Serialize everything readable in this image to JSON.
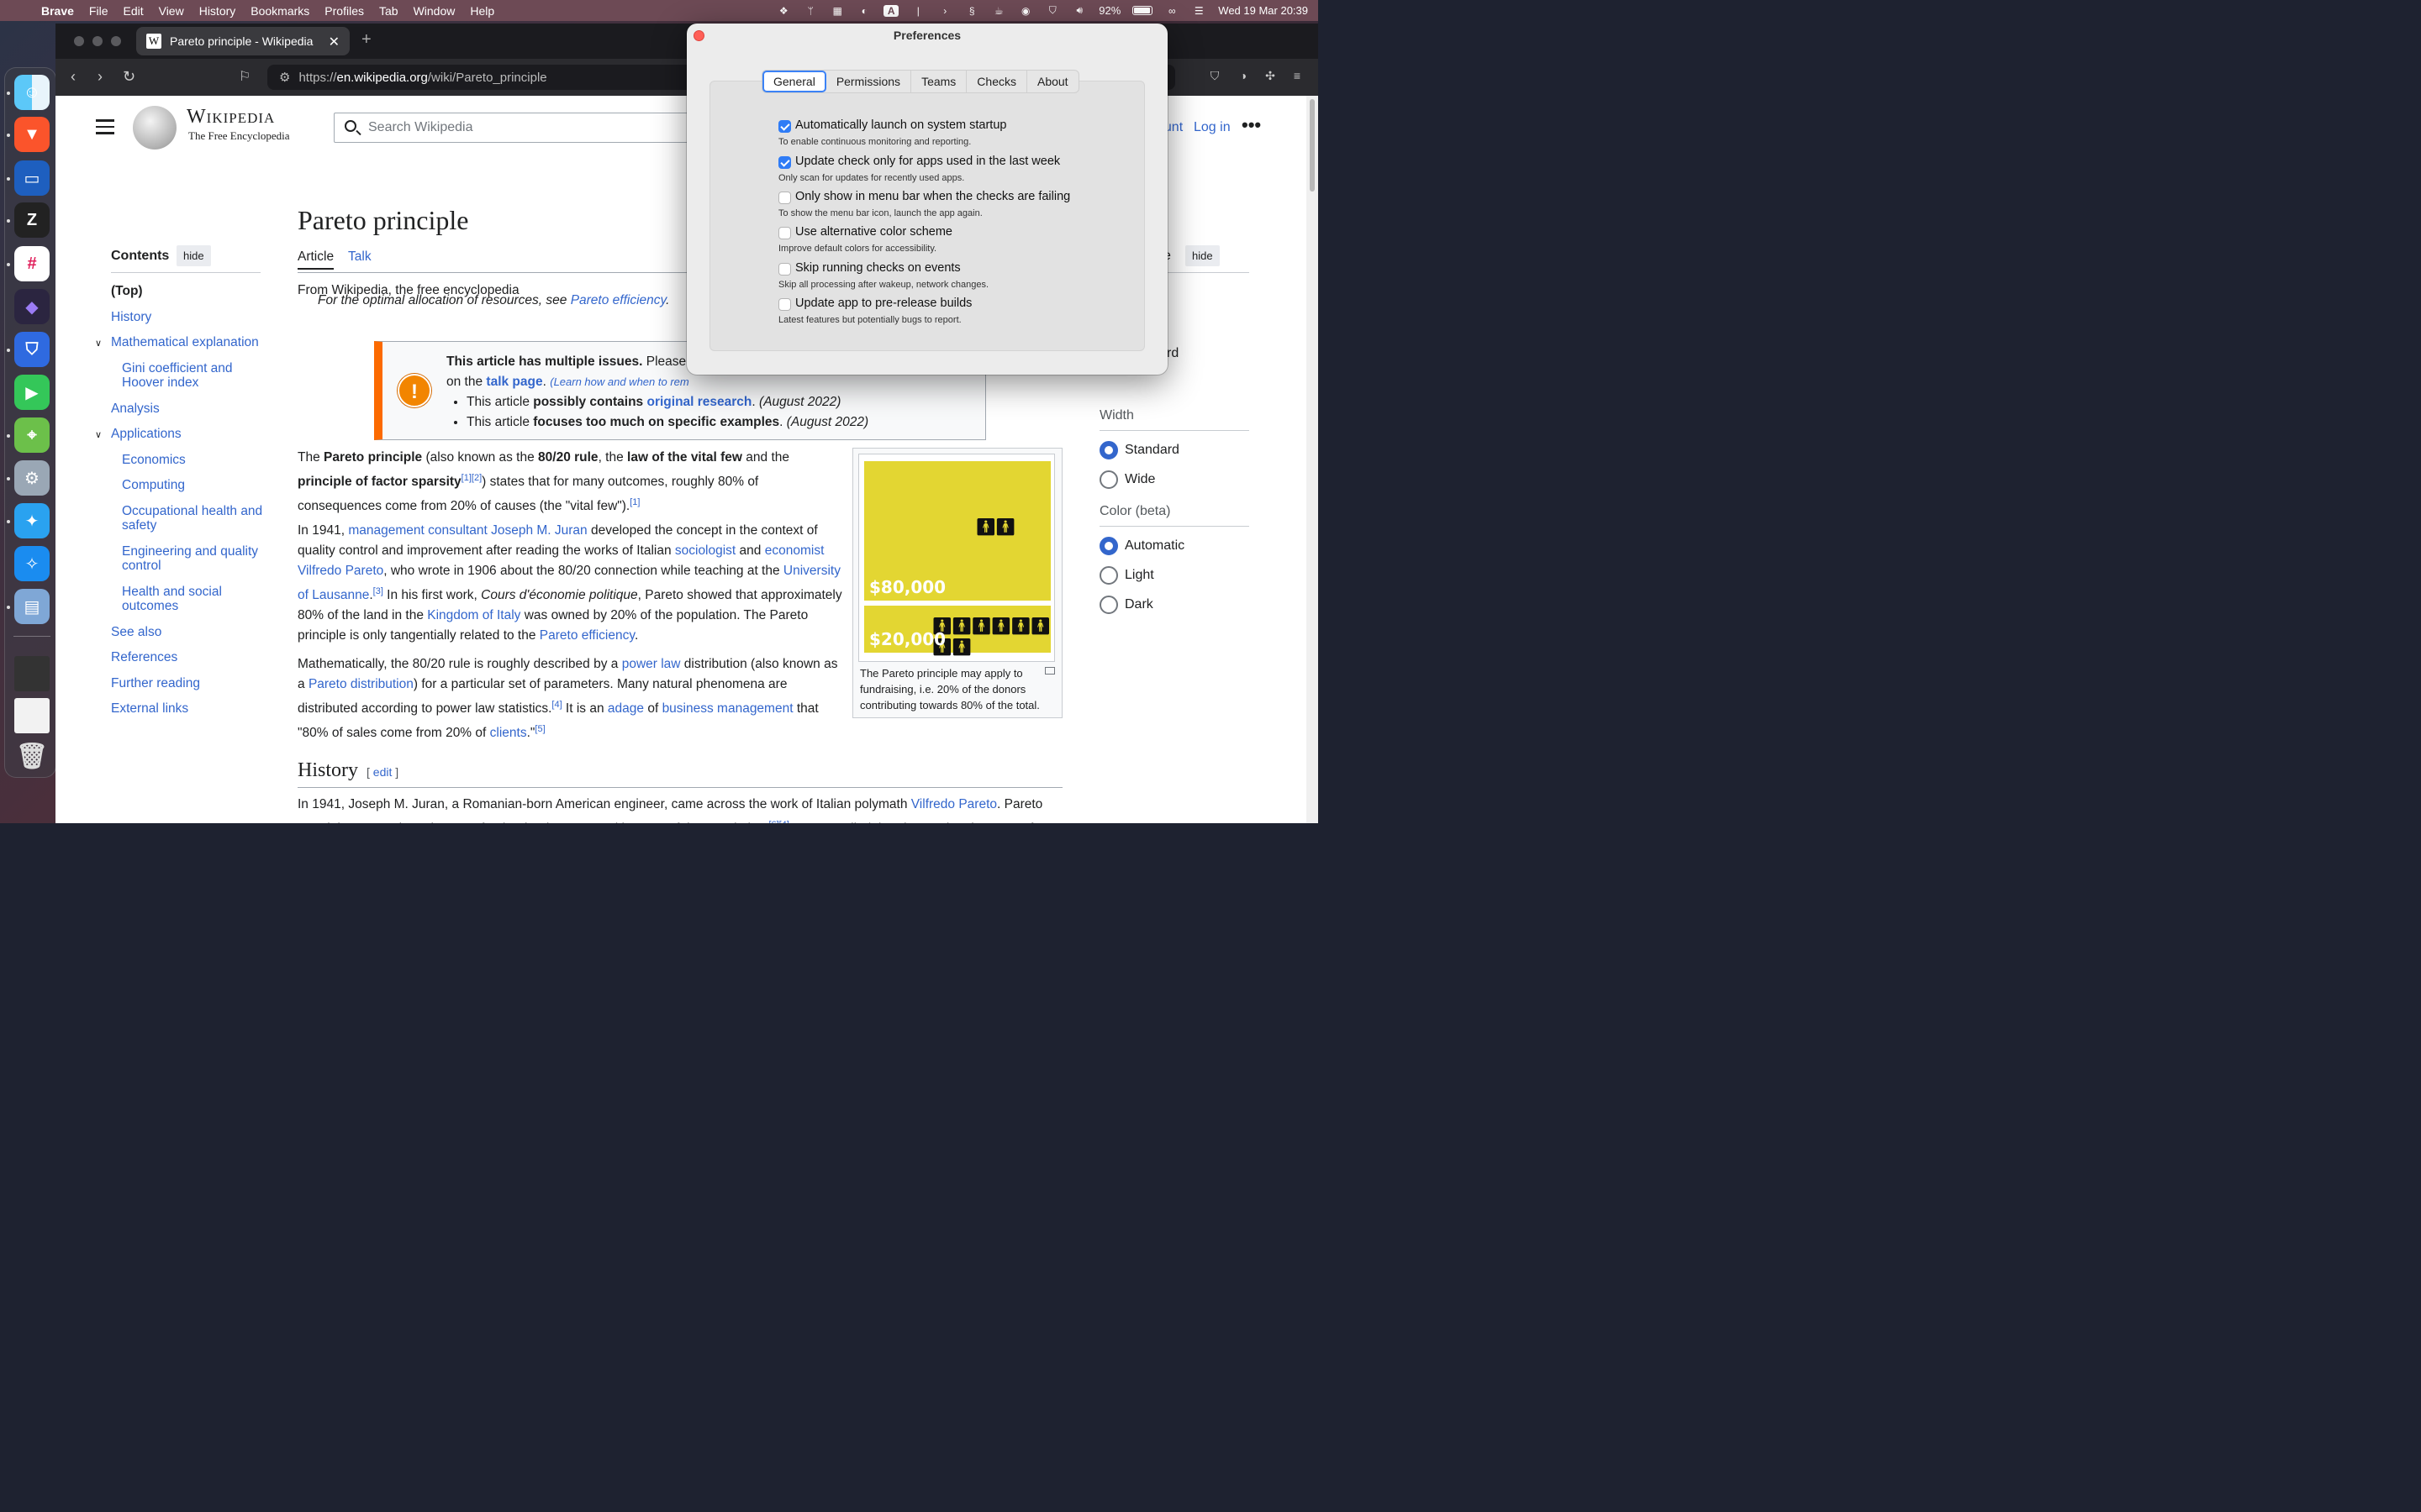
{
  "menubar": {
    "app": "Brave",
    "items": [
      "File",
      "Edit",
      "View",
      "History",
      "Bookmarks",
      "Profiles",
      "Tab",
      "Window",
      "Help"
    ],
    "battery": "92%",
    "datetime": "Wed 19 Mar  20:39"
  },
  "browser": {
    "tab_title": "Pareto principle - Wikipedia",
    "url_scheme": "https://",
    "url_host": "en.wikipedia.org",
    "url_path": "/wiki/Pareto_principle"
  },
  "wiki": {
    "wordmark": "Wikipedia",
    "tagline": "The Free Encyclopedia",
    "search_placeholder": "Search Wikipedia",
    "account_fragment": "ount",
    "login": "Log in",
    "toc": {
      "title": "Contents",
      "hide": "hide",
      "items": [
        "(Top)",
        "History",
        "Mathematical explanation",
        "Gini coefficient and",
        "Hoover index",
        "Analysis",
        "Applications",
        "Economics",
        "Computing",
        "Occupational health and",
        "safety",
        "Engineering and quality",
        "control",
        "Health and social",
        "outcomes",
        "See also",
        "References",
        "Further reading",
        "External links"
      ]
    },
    "article": {
      "title": "Pareto principle",
      "tab_article": "Article",
      "tab_talk": "Talk",
      "from": "From Wikipedia, the free encyclopedia",
      "hatnote_pre": "For the optimal allocation of resources, see ",
      "hatnote_link": "Pareto efficiency",
      "hatnote_post": ".",
      "ambox_bold": "This article has multiple issues.",
      "ambox_rest": " Please",
      "ambox_line2_pre": "on the ",
      "ambox_talk": "talk page",
      "ambox_line2_small": "(Learn how and when to rem",
      "ambox_b1_pre": "This article ",
      "ambox_b1_bold": "possibly contains",
      "ambox_b1_link": "original research",
      "ambox_b1_date": "(August 2022)",
      "ambox_b2_pre": "This article ",
      "ambox_b2_bold": "focuses too much on specific examples",
      "ambox_b2_date": "(August 2022)",
      "h2_history": "History",
      "h2_edit": "edit"
    },
    "infobox": {
      "big_amount": "$80,000",
      "small_amount": "$20,000",
      "caption": "The Pareto principle may apply to fundraising, i.e. 20% of the donors contributing towards 80% of the total."
    },
    "appearance": {
      "hide": "hide",
      "fragment_e": "e",
      "fragment_rd": "rd",
      "width_label": "Width",
      "width_options": [
        "Standard",
        "Wide"
      ],
      "color_label": "Color (beta)",
      "color_options": [
        "Automatic",
        "Light",
        "Dark"
      ]
    }
  },
  "prefs": {
    "title": "Preferences",
    "tabs": [
      "General",
      "Permissions",
      "Teams",
      "Checks",
      "About"
    ],
    "options": [
      {
        "label": "Automatically launch on system startup",
        "sub": "To enable continuous monitoring and reporting.",
        "checked": true
      },
      {
        "label": "Update check only for apps used in the last week",
        "sub": "Only scan for updates for recently used apps.",
        "checked": true
      },
      {
        "label": "Only show in menu bar when the checks are failing",
        "sub": "To show the menu bar icon, launch the app again.",
        "checked": false
      },
      {
        "label": "Use alternative color scheme",
        "sub": "Improve default colors for accessibility.",
        "checked": false
      },
      {
        "label": "Skip running checks on events",
        "sub": "Skip all processing after wakeup, network changes.",
        "checked": false
      },
      {
        "label": "Update app to pre-release builds",
        "sub": "Latest features but potentially bugs to report.",
        "checked": false
      }
    ]
  }
}
